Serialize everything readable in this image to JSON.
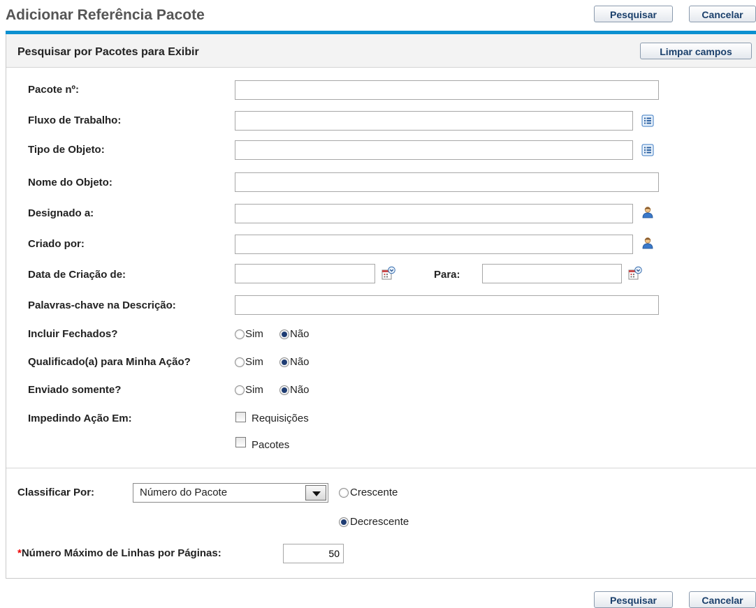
{
  "page": {
    "title": "Adicionar Referência Pacote",
    "search_label": "Pesquisar",
    "cancel_label": "Cancelar"
  },
  "panel": {
    "title": "Pesquisar por Pacotes para Exibir",
    "clear_label": "Limpar campos"
  },
  "fields": {
    "package_no": {
      "label": "Pacote nº:",
      "value": ""
    },
    "workflow": {
      "label": "Fluxo de Trabalho:",
      "value": "",
      "icon": "list-icon"
    },
    "object_type": {
      "label": "Tipo de Objeto:",
      "value": "",
      "icon": "list-icon"
    },
    "object_name": {
      "label": "Nome do Objeto:",
      "value": ""
    },
    "assigned_to": {
      "label": "Designado a:",
      "value": "",
      "icon": "user-icon"
    },
    "created_by": {
      "label": "Criado por:",
      "value": "",
      "icon": "user-icon"
    },
    "created_from": {
      "label": "Data de Criação de:",
      "value": "",
      "icon": "calendar-icon"
    },
    "created_to": {
      "label": "Para:",
      "value": "",
      "icon": "calendar-icon"
    },
    "keywords": {
      "label": "Palavras-chave na Descrição:",
      "value": ""
    }
  },
  "radios": {
    "include_closed": {
      "label": "Incluir Fechados?",
      "yes": "Sim",
      "no": "Não",
      "selected": "Não"
    },
    "qualified": {
      "label": "Qualificado(a) para Minha Ação?",
      "yes": "Sim",
      "no": "Não",
      "selected": "Não"
    },
    "sent_only": {
      "label": "Enviado somente?",
      "yes": "Sim",
      "no": "Não",
      "selected": "Não"
    }
  },
  "blocking": {
    "label": "Impedindo Ação Em:",
    "options": [
      {
        "label": "Requisições",
        "checked": false
      },
      {
        "label": "Pacotes",
        "checked": false
      }
    ]
  },
  "sort": {
    "label": "Classificar Por:",
    "selected": "Número do Pacote",
    "ascending": "Crescente",
    "descending": "Decrescente",
    "order_selected": "Decrescente"
  },
  "max_rows": {
    "required_mark": "*",
    "label": "Número Máximo de Linhas por Páginas:",
    "value": "50"
  },
  "colors": {
    "accent": "#0c90d0",
    "button_text": "#1a3f6b",
    "required": "#ee0000"
  }
}
